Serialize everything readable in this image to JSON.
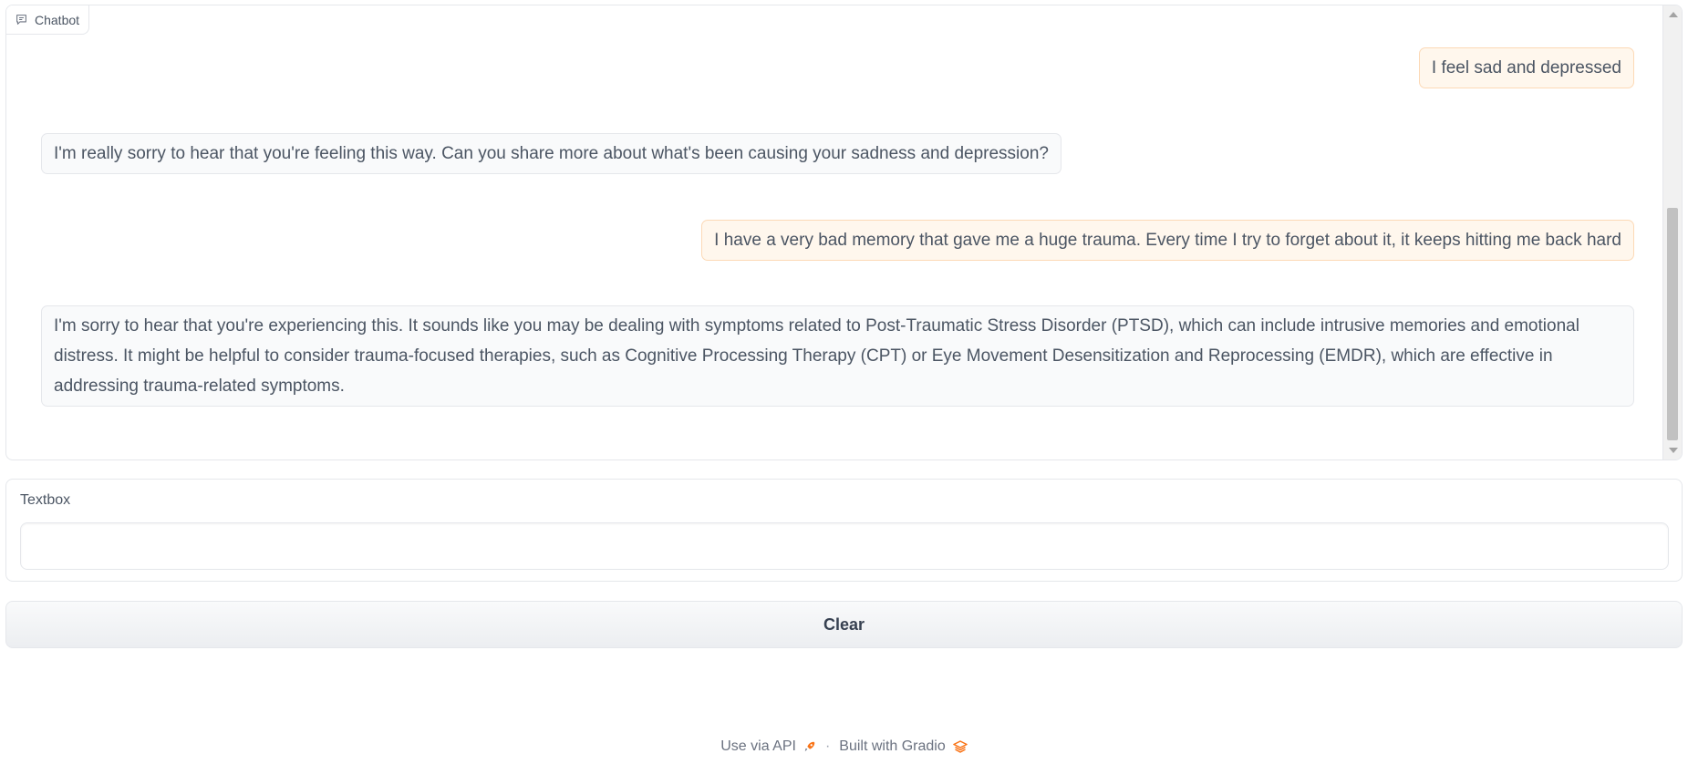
{
  "chatbot": {
    "label": "Chatbot",
    "messages": [
      {
        "role": "user",
        "text": "I feel sad and depressed"
      },
      {
        "role": "bot",
        "text": "I'm really sorry to hear that you're feeling this way. Can you share more about what's been causing your sadness and depression?"
      },
      {
        "role": "user",
        "text": "I have a very bad memory that gave me a huge trauma. Every time I try to forget about it, it keeps hitting me back hard"
      },
      {
        "role": "bot",
        "text": "I'm sorry to hear that you're experiencing this. It sounds like you may be dealing with symptoms related to Post-Traumatic Stress Disorder (PTSD), which can include intrusive memories and emotional distress. It might be helpful to consider trauma-focused therapies, such as Cognitive Processing Therapy (CPT) or Eye Movement Desensitization and Reprocessing (EMDR), which are effective in addressing trauma-related symptoms."
      }
    ]
  },
  "textbox": {
    "label": "Textbox",
    "value": "",
    "placeholder": ""
  },
  "clear_button": {
    "label": "Clear"
  },
  "footer": {
    "api_link": "Use via API",
    "separator": "·",
    "built_with": "Built with Gradio"
  },
  "icons": {
    "chatbot": "chat-icon",
    "api": "rocket-icon",
    "gradio": "gradio-logo-icon"
  },
  "colors": {
    "user_bubble": "#fff7ed",
    "user_border": "#fcd9b6",
    "bot_bubble": "#f9fafb",
    "accent": "#f97316"
  }
}
